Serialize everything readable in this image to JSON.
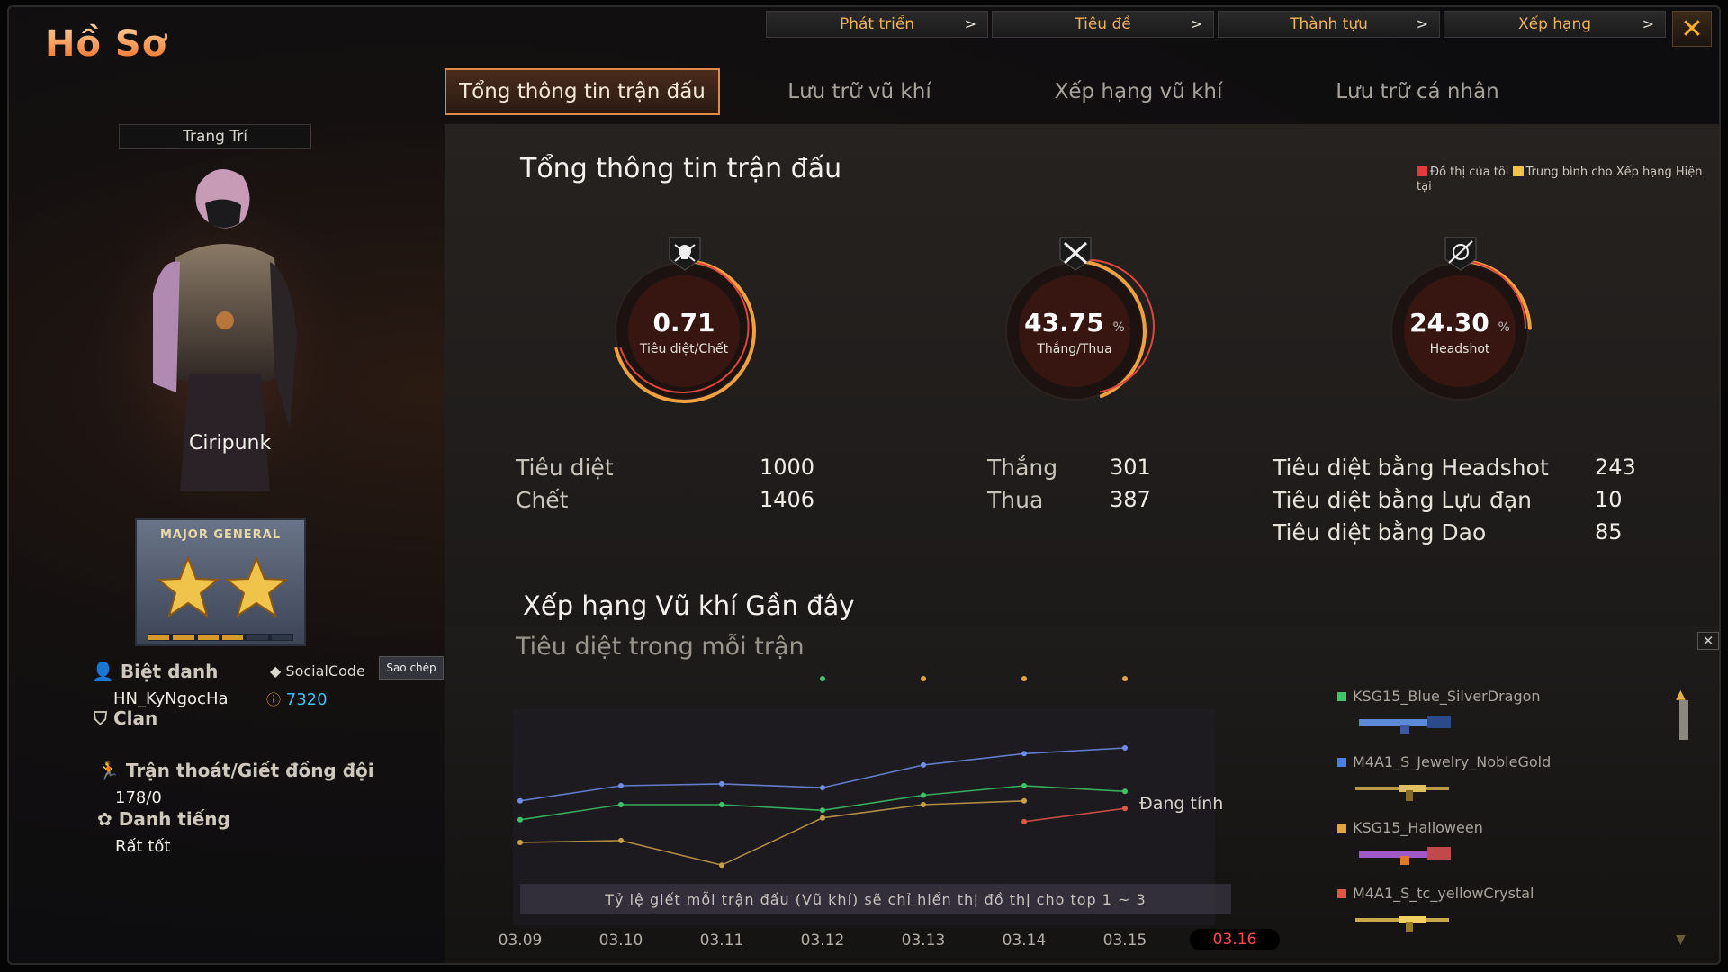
{
  "app": {
    "title": "Hồ Sơ"
  },
  "top_nav": [
    {
      "label": "Phát triển"
    },
    {
      "label": "Tiêu đề"
    },
    {
      "label": "Thành tựu"
    },
    {
      "label": "Xếp hạng"
    }
  ],
  "top_nav_chevron": ">",
  "close_glyph": "✕",
  "tabs": [
    {
      "label": "Tổng thông tin trận đấu",
      "active": true
    },
    {
      "label": "Lưu trữ vũ khí",
      "active": false
    },
    {
      "label": "Xếp hạng vũ khí",
      "active": false
    },
    {
      "label": "Lưu trữ cá nhân",
      "active": false
    }
  ],
  "profile": {
    "decor_label": "Trang Trí",
    "character_name": "Ciripunk",
    "rank_name": "MAJOR GENERAL",
    "rank_stars": 2,
    "nickname_label": "Biệt danh",
    "nickname": "HN_KyNgocHa",
    "socialcode_label": "SocialCode",
    "copy_label": "Sao chép",
    "socialcode_value": "7320",
    "clan_label": "Clan",
    "teamkill_label": "Trận thoát/Giết đồng đội",
    "teamkill_value": "178/0",
    "reputation_label": "Danh tiếng",
    "reputation_value": "Rất tốt"
  },
  "stats": {
    "title": "Tổng thông tin trận đấu",
    "legend": {
      "mine": "Đồ thị của tôi",
      "avg": "Trung bình cho Xếp hạng Hiện tại",
      "mine_color": "#e23b3b",
      "avg_color": "#f2c14a"
    },
    "gauges": [
      {
        "value": "0.71",
        "unit": "",
        "label": "Tiêu diệt/Chết",
        "icon": "skull-crossbones-icon",
        "level": 0.71
      },
      {
        "value": "43.75",
        "unit": "%",
        "label": "Thắng/Thua",
        "icon": "crossed-swords-icon",
        "level": 0.4375
      },
      {
        "value": "24.30",
        "unit": "%",
        "label": "Headshot",
        "icon": "crosshair-icon",
        "level": 0.243
      }
    ],
    "kills_label": "Tiêu diệt",
    "kills": "1000",
    "deaths_label": "Chết",
    "deaths": "1406",
    "wins_label": "Thắng",
    "wins": "301",
    "losses_label": "Thua",
    "losses": "387",
    "hs_kills_label": "Tiêu diệt bằng Headshot",
    "hs_kills": "243",
    "grenade_kills_label": "Tiêu diệt bằng Lựu đạn",
    "grenade_kills": "10",
    "knife_kills_label": "Tiêu diệt bằng Dao",
    "knife_kills": "85"
  },
  "recent": {
    "title": "Xếp hạng Vũ khí Gần đây",
    "subtitle": "Tiêu diệt trong mỗi trận",
    "status": "Đang tính",
    "note": "Tỷ lệ giết mỗi trận đấu (Vũ khí) sẽ chỉ hiển thị đồ thị cho top 1 ~ 3",
    "weapons": [
      {
        "name": "KSG15_Blue_SilverDragon",
        "color": "#3ec46a"
      },
      {
        "name": "M4A1_S_Jewelry_NobleGold",
        "color": "#4c7ee8"
      },
      {
        "name": "KSG15_Halloween",
        "color": "#e2a640"
      },
      {
        "name": "M4A1_S_tc_yellowCrystal",
        "color": "#e2564a"
      }
    ]
  },
  "chart_data": {
    "type": "line",
    "categories": [
      "03.09",
      "03.10",
      "03.11",
      "03.12",
      "03.13",
      "03.14",
      "03.15",
      "03.16"
    ],
    "active_category": "03.16",
    "ylim": [
      0,
      10
    ],
    "series": [
      {
        "name": "KSG15_Blue_SilverDragon",
        "color": "#3ec46a",
        "values": [
          3.2,
          4.0,
          4.0,
          3.7,
          4.5,
          5.0,
          4.7,
          null
        ]
      },
      {
        "name": "M4A1_S_Jewelry_NobleGold",
        "color": "#6f8ee8",
        "values": [
          4.2,
          5.0,
          5.1,
          4.9,
          6.1,
          6.7,
          7.0,
          null
        ]
      },
      {
        "name": "KSG15_Halloween",
        "color": "#c9a04a",
        "values": [
          2.0,
          2.1,
          0.8,
          3.3,
          4.0,
          4.2,
          null,
          null
        ]
      },
      {
        "name": "M4A1_S_tc_yellowCrystal",
        "color": "#e2564a",
        "values": [
          null,
          null,
          null,
          null,
          null,
          3.1,
          3.8,
          null
        ]
      }
    ],
    "top_markers": [
      {
        "category": "03.12",
        "color": "#3ec46a"
      },
      {
        "category": "03.13",
        "color": "#e2a640"
      },
      {
        "category": "03.14",
        "color": "#e2a640"
      },
      {
        "category": "03.15",
        "color": "#e2a640"
      }
    ]
  }
}
